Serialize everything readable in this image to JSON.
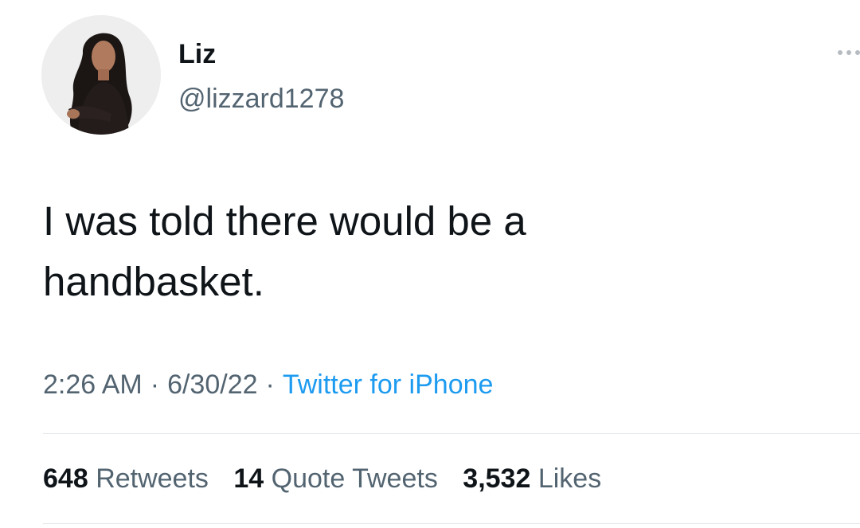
{
  "tweet": {
    "author_name": "Liz",
    "author_handle": "@lizzard1278",
    "text": "I was told there would be a\nhandbasket.",
    "time": "2:26 AM",
    "date": "6/30/22",
    "source": "Twitter for iPhone",
    "separator": "·",
    "stats": {
      "retweets_count": "648",
      "retweets_label": "Retweets",
      "quotes_count": "14",
      "quotes_label": "Quote Tweets",
      "likes_count": "3,532",
      "likes_label": "Likes"
    }
  },
  "icons": {
    "avatar": "profile-photo",
    "more": "more-options-icon"
  },
  "colors": {
    "primary_text": "#0f1419",
    "secondary_text": "#536471",
    "link": "#1d9bf0",
    "divider": "#e4e7ea"
  }
}
